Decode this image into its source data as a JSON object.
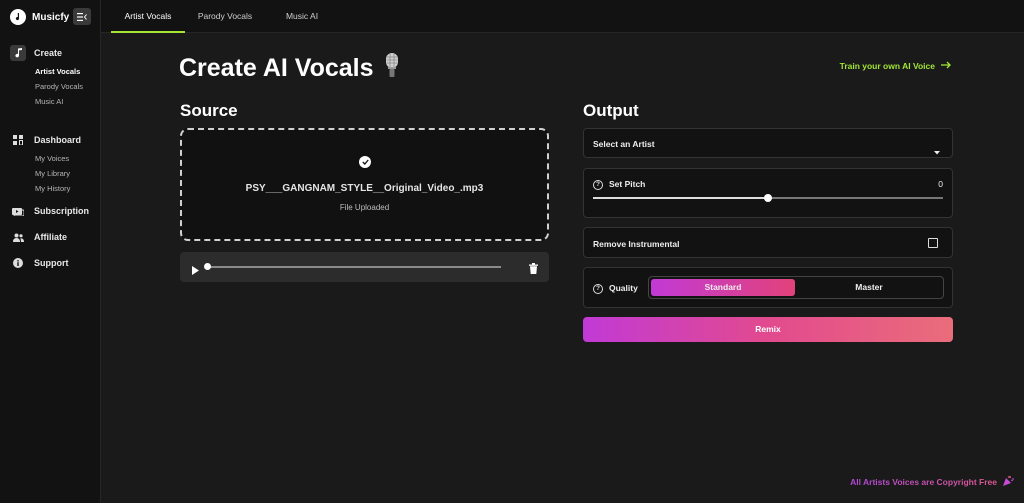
{
  "app": {
    "name": "Musicfy"
  },
  "sidebar": {
    "groups": [
      {
        "label": "Create",
        "icon": "music-note-icon",
        "items": [
          "Artist Vocals",
          "Parody Vocals",
          "Music AI"
        ]
      },
      {
        "label": "Dashboard",
        "icon": "dashboard-icon",
        "items": [
          "My Voices",
          "My Library",
          "My History"
        ]
      },
      {
        "label": "Subscription",
        "icon": "subscription-icon",
        "items": []
      },
      {
        "label": "Affiliate",
        "icon": "users-icon",
        "items": []
      },
      {
        "label": "Support",
        "icon": "info-icon",
        "items": []
      }
    ],
    "active_item": "Artist Vocals"
  },
  "tabs": [
    "Artist Vocals",
    "Parody Vocals",
    "Music AI"
  ],
  "active_tab": "Artist Vocals",
  "page": {
    "title": "Create AI Vocals",
    "title_icon": "microphone-icon",
    "train_link": "Train your own AI Voice"
  },
  "source": {
    "title": "Source",
    "file_name": "PSY___GANGNAM_STYLE__Original_Video_.mp3",
    "status": "File Uploaded",
    "player_progress": 0
  },
  "output": {
    "title": "Output",
    "artist_select": "Select an Artist",
    "pitch_label": "Set Pitch",
    "pitch_value": "0",
    "pitch_position": 0.5,
    "remove_instrumental_label": "Remove Instrumental",
    "remove_instrumental_checked": false,
    "quality_label": "Quality",
    "quality_options": [
      "Standard",
      "Master"
    ],
    "quality_selected": "Standard",
    "remix_label": "Remix"
  },
  "footer": {
    "note": "All Artists Voices are Copyright Free"
  },
  "colors": {
    "accent": "#a3e635",
    "gradient_start": "#c13ad6",
    "gradient_end": "#e2427a",
    "background": "#1a1a1a"
  }
}
